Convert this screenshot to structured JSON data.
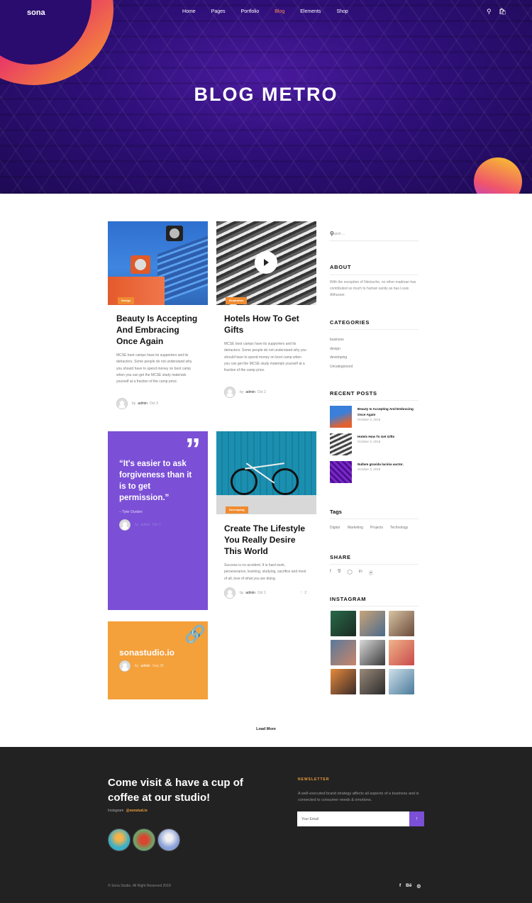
{
  "nav": {
    "logo": "sona",
    "items": [
      "Home",
      "Pages",
      "Portfolio",
      "Blog",
      "Elements",
      "Shop"
    ],
    "active": "Blog"
  },
  "hero": {
    "title": "BLOG METRO"
  },
  "posts": [
    {
      "tag": "Design",
      "title": "Beauty Is Accepting And Embracing Once Again",
      "excerpt": "MCSE boot camps have its supporters and its detractors. Some people do not understand why you should have to spend money on boot camp when you can get the MCSE study materials yourself at a fraction of the camp price.",
      "by": "by",
      "author": "admin",
      "date": "Oct 3"
    },
    {
      "tag": "Illustration",
      "title": "Hotels How To Get Gifts",
      "excerpt": "MCSE boot camps have its supporters and its detractors. Some people do not understand why you should have to spend money on boot camp when you can get the MCSE study materials yourself at a fraction of the camp price.",
      "by": "by",
      "author": "admin",
      "date": "Oct 2"
    },
    {
      "tag": "Developing",
      "title": "Create The Lifestyle You Really Desire This World",
      "excerpt": "Success is no accident. It is hard work, perseverance, learning, studying, sacrifice and most of all, love of what you are doing.",
      "by": "by",
      "author": "admin",
      "date": "Oct 1",
      "likes": "2"
    }
  ],
  "quote": {
    "text": "“It's easier to ask forgiveness than it is to get permission.”",
    "author": "– Tyler Durden",
    "by": "by",
    "meta_author": "admin",
    "date": "Oct 1"
  },
  "link_post": {
    "title": "sonastudio.io",
    "by": "by",
    "author": "admin",
    "date": "Sep 30"
  },
  "load_more": "Load More",
  "sidebar": {
    "search_placeholder": "Search ...",
    "about": {
      "title": "ABOUT",
      "text": "With the exception of Nietzsche, no other madman has contributed so much to human sanity as has Louis Althusser."
    },
    "categories": {
      "title": "CATEGORIES",
      "items": [
        "business",
        "design",
        "developing",
        "Uncategorized"
      ]
    },
    "recent": {
      "title": "RECENT POSTS",
      "items": [
        {
          "title": "Beauty Is Accepting And Embracing Once Again",
          "date": "October 3, 2018"
        },
        {
          "title": "Hotels How To Get Gifts",
          "date": "October 3, 2018"
        },
        {
          "title": "Nullam gravida lacinia auctor.",
          "date": "October 3, 2018"
        }
      ]
    },
    "tags": {
      "title": "Tags",
      "items": [
        "Digital",
        "Marketing",
        "Projects",
        "Technology"
      ]
    },
    "share": {
      "title": "SHARE",
      "icons": [
        "facebook-icon",
        "twitter-icon",
        "instagram-icon",
        "linkedin-icon",
        "pinterest-icon"
      ]
    },
    "instagram": {
      "title": "INSTAGRAM"
    }
  },
  "footer": {
    "headline": "Come visit & have a cup of coffee at our studio!",
    "instagram_label": "Instagram",
    "instagram_handle": "@sonstud.io",
    "newsletter_title": "NEWSLETTER",
    "newsletter_text": "A well-executed brand strategy affects all aspects of a business and is connected to consumer needs & emotions.",
    "email_placeholder": "Your Email",
    "copyright": "© Sona Studio. All Right Reserved 2018",
    "social": [
      "facebook-icon",
      "behance-icon",
      "dribbble-icon"
    ]
  },
  "colors": {
    "accent_orange": "#f4a03b",
    "accent_purple": "#7b4fd6",
    "nav_active": "#ff8a55",
    "footer_bg": "#222222"
  }
}
